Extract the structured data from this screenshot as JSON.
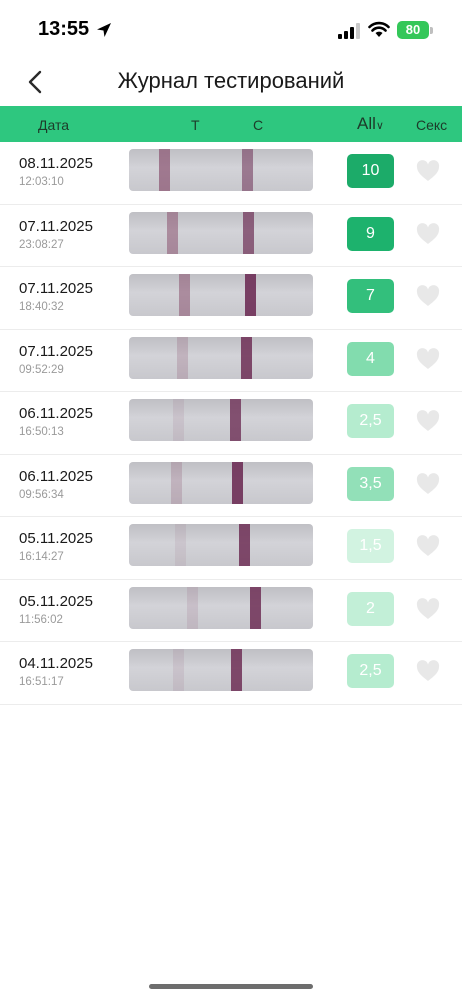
{
  "status": {
    "time": "13:55",
    "battery": "80"
  },
  "header": {
    "title": "Журнал тестирований"
  },
  "table_header": {
    "date": "Дата",
    "t": "T",
    "c": "C",
    "filter": "All",
    "sex": "Секс"
  },
  "rows": [
    {
      "date": "08.11.2025",
      "time": "12:03:10",
      "score": "10",
      "score_color": "#1cab69",
      "t_line_opacity": 0.7,
      "c_line_opacity": 0.55
    },
    {
      "date": "07.11.2025",
      "time": "23:08:27",
      "score": "9",
      "score_color": "#1db26d",
      "t_line_opacity": 0.55,
      "c_line_opacity": 0.7
    },
    {
      "date": "07.11.2025",
      "time": "18:40:32",
      "score": "7",
      "score_color": "#33bf7c",
      "t_line_opacity": 0.55,
      "c_line_opacity": 0.9
    },
    {
      "date": "07.11.2025",
      "time": "09:52:29",
      "score": "4",
      "score_color": "#82dcae",
      "t_line_opacity": 0.25,
      "c_line_opacity": 0.85
    },
    {
      "date": "06.11.2025",
      "time": "16:50:13",
      "score": "2,5",
      "score_color": "#b5eccf",
      "t_line_opacity": 0.12,
      "c_line_opacity": 0.8
    },
    {
      "date": "06.11.2025",
      "time": "09:56:34",
      "score": "3,5",
      "score_color": "#92e0b8",
      "t_line_opacity": 0.25,
      "c_line_opacity": 0.9
    },
    {
      "date": "05.11.2025",
      "time": "16:14:27",
      "score": "1,5",
      "score_color": "#d2f3e1",
      "t_line_opacity": 0.1,
      "c_line_opacity": 0.85
    },
    {
      "date": "05.11.2025",
      "time": "11:56:02",
      "score": "2",
      "score_color": "#c2efd7",
      "t_line_opacity": 0.15,
      "c_line_opacity": 0.85
    },
    {
      "date": "04.11.2025",
      "time": "16:51:17",
      "score": "2,5",
      "score_color": "#b5eccf",
      "t_line_opacity": 0.12,
      "c_line_opacity": 0.85
    }
  ]
}
